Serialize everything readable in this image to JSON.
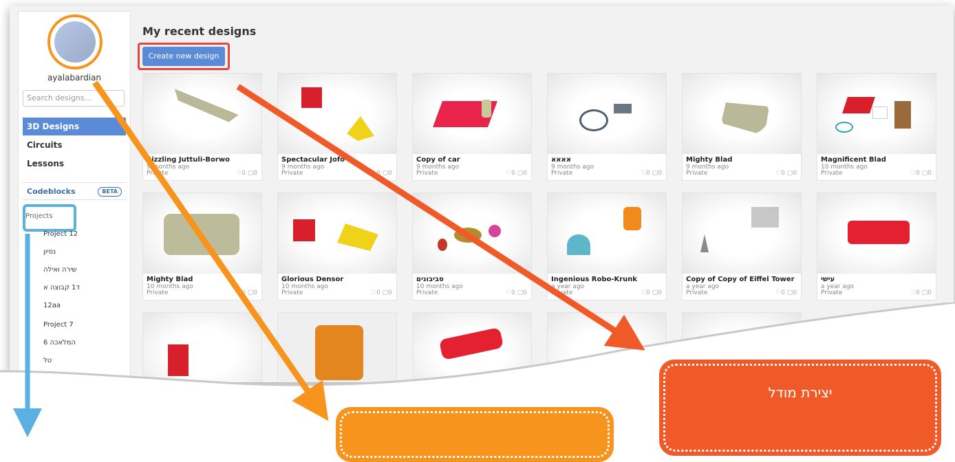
{
  "sidebar": {
    "username": "ayalabardian",
    "search_placeholder": "Search designs...",
    "nav": [
      "3D Designs",
      "Circuits",
      "Lessons"
    ],
    "codeblocks": "Codeblocks",
    "beta": "BETA",
    "projects_label": "Projects",
    "projects": [
      "Project 12",
      "נסיון",
      "שירה ואילה",
      "ד1 קבוצה א",
      "12aa",
      "Project 7",
      "המלאכה 6",
      "טל"
    ]
  },
  "main": {
    "title": "My recent designs",
    "create_button": "Create new design",
    "designs": [
      {
        "title": "Sizzling Juttuli-Borwo",
        "date": "9 months ago",
        "privacy": "Private",
        "stats": "♡0 ▢0"
      },
      {
        "title": "Spectacular Jofo",
        "date": "9 months ago",
        "privacy": "Private",
        "stats": "♡0 ▢0"
      },
      {
        "title": "Copy of car",
        "date": "9 months ago",
        "privacy": "Private",
        "stats": "♡0 ▢0"
      },
      {
        "title": "אאאא",
        "date": "9 months ago",
        "privacy": "Private",
        "stats": "♡0 ▢0"
      },
      {
        "title": "Mighty Blad",
        "date": "9 months ago",
        "privacy": "Private",
        "stats": "♡0 ▢0"
      },
      {
        "title": "Magnificent Blad",
        "date": "10 months ago",
        "privacy": "Private",
        "stats": "♡0 ▢0"
      },
      {
        "title": "Mighty Blad",
        "date": "10 months ago",
        "privacy": "Private",
        "stats": "♡0 ▢0"
      },
      {
        "title": "Glorious Densor",
        "date": "10 months ago",
        "privacy": "Private",
        "stats": "♡0 ▢0"
      },
      {
        "title": "סביבונים",
        "date": "10 months ago",
        "privacy": "Private",
        "stats": "♡0 ▢0"
      },
      {
        "title": "Ingenious Robo-Krunk",
        "date": "a year ago",
        "privacy": "Private",
        "stats": "♡0 ▢0"
      },
      {
        "title": "Copy of Copy of Eiffel Tower",
        "date": "a year ago",
        "privacy": "Private",
        "stats": "♡0 ▢0"
      },
      {
        "title": "עישי",
        "date": "a year ago",
        "privacy": "Private",
        "stats": "♡0 ▢0"
      }
    ]
  },
  "callouts": {
    "red_text": "יצירת מודל"
  },
  "colors": {
    "accent_blue": "#5b8bd6",
    "callout_red": "#f05a28",
    "callout_orange": "#f7941d",
    "projects_highlight": "#5ab0e0"
  }
}
